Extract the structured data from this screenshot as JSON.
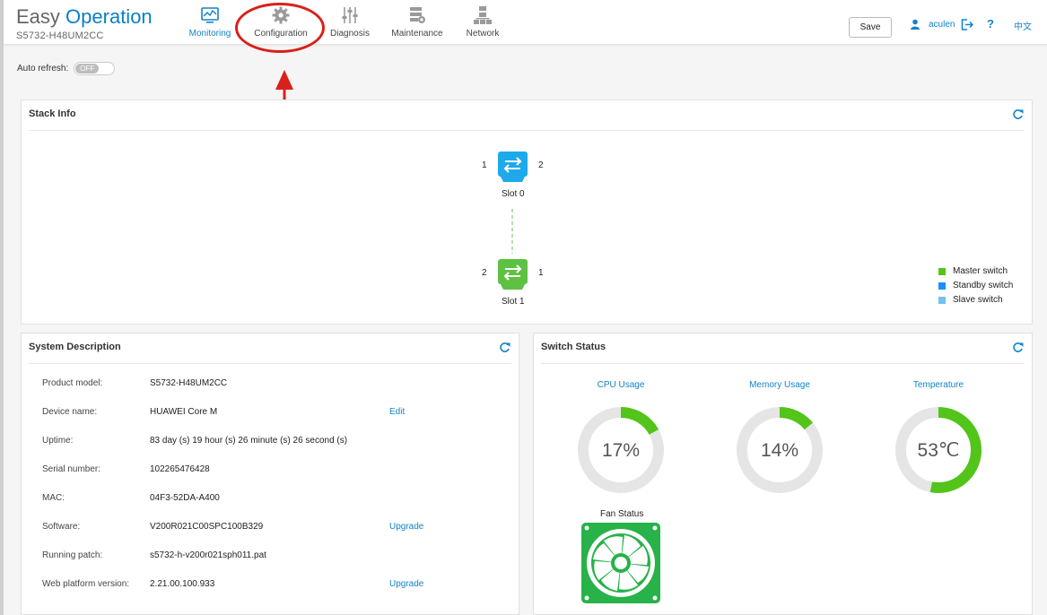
{
  "app": {
    "title_easy": "Easy",
    "title_operation": "Operation",
    "device_model": "S5732-H48UM2CC"
  },
  "nav": {
    "items": [
      {
        "label": "Monitoring",
        "icon": "monitor-icon",
        "active": true
      },
      {
        "label": "Configuration",
        "icon": "gear-icon"
      },
      {
        "label": "Diagnosis",
        "icon": "sliders-icon"
      },
      {
        "label": "Maintenance",
        "icon": "maintenance-icon"
      },
      {
        "label": "Network",
        "icon": "network-icon"
      }
    ]
  },
  "header_actions": {
    "save_label": "Save",
    "username": "aculen",
    "help": "?",
    "language": "中文"
  },
  "auto_refresh": {
    "label": "Auto refresh:",
    "state": "OFF"
  },
  "stack_info": {
    "title": "Stack Info",
    "slots": [
      {
        "name": "Slot 0",
        "left_port": "1",
        "right_port": "2",
        "role": "standby",
        "color": "#1ea9ea"
      },
      {
        "name": "Slot 1",
        "left_port": "2",
        "right_port": "1",
        "role": "master",
        "color": "#5dc142"
      }
    ],
    "legend": [
      {
        "label": "Master switch",
        "color": "#52c41a"
      },
      {
        "label": "Standby switch",
        "color": "#1890ff"
      },
      {
        "label": "Slave switch",
        "color": "#74c0f0"
      }
    ]
  },
  "system_description": {
    "title": "System Description",
    "rows": [
      {
        "label": "Product model:",
        "value": "S5732-H48UM2CC",
        "action": ""
      },
      {
        "label": "Device name:",
        "value": "HUAWEI Core M",
        "action": "Edit"
      },
      {
        "label": "Uptime:",
        "value": "83 day (s) 19 hour (s) 26 minute (s) 26 second (s)",
        "action": ""
      },
      {
        "label": "Serial number:",
        "value": "102265476428",
        "action": ""
      },
      {
        "label": "MAC:",
        "value": "04F3-52DA-A400",
        "action": ""
      },
      {
        "label": "Software:",
        "value": "V200R021C00SPC100B329",
        "action": "Upgrade"
      },
      {
        "label": "Running patch:",
        "value": "s5732-h-v200r021sph011.pat",
        "action": ""
      },
      {
        "label": "Web platform version:",
        "value": "2.21.00.100.933",
        "action": "Upgrade"
      }
    ]
  },
  "switch_status": {
    "title": "Switch Status",
    "gauges": [
      {
        "label": "CPU Usage",
        "value": 17,
        "display": "17%"
      },
      {
        "label": "Memory Usage",
        "value": 14,
        "display": "14%"
      },
      {
        "label": "Temperature",
        "value": 53,
        "display": "53℃"
      }
    ],
    "fan_label": "Fan Status",
    "gauge_color": "#52c41a",
    "track_color": "#e5e5e5"
  }
}
